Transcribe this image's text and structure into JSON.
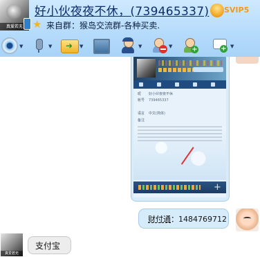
{
  "header": {
    "title": "好小伙夜夜不休，(739465337)",
    "vip_badge": "SVIP5",
    "avatar_caption": "真爱若无",
    "group_prefix": "来自群：",
    "group_name": "猴岛交流群-各种买卖."
  },
  "toolbar": {
    "items": [
      {
        "name": "video",
        "icon": "webcam-icon"
      },
      {
        "name": "voice",
        "icon": "microphone-icon"
      },
      {
        "name": "send-file",
        "icon": "folder-send-icon"
      },
      {
        "name": "remote-screen",
        "icon": "monitor-icon"
      },
      {
        "name": "profile",
        "icon": "police-user-icon"
      },
      {
        "name": "block",
        "icon": "user-block-icon"
      },
      {
        "name": "add-friend",
        "icon": "user-add-icon"
      },
      {
        "name": "message",
        "icon": "message-add-icon"
      }
    ]
  },
  "screenshot_bubble": {
    "qq_number": "739465337",
    "rows": [
      {
        "key": "昵",
        "value": "好小伙夜夜不休"
      },
      {
        "key": "帐号",
        "value": "739465337"
      },
      {
        "key": "",
        "value": ""
      },
      {
        "key": "语言",
        "value": "中文(简体)"
      },
      {
        "key": "备注",
        "value": ""
      }
    ]
  },
  "messages": [
    {
      "from": "peer",
      "label": "财付通",
      "sep": "：",
      "number": "1484769712"
    },
    {
      "from": "me",
      "avatar_caption": "真爱若无",
      "text": "支付宝"
    }
  ],
  "colors": {
    "header_bg": "#b7dcfb",
    "title_text": "#0d2e6b",
    "bubble_blue": "#d7ecfb",
    "bubble_grey": "#ededed",
    "vip_orange": "#f19a1b"
  }
}
